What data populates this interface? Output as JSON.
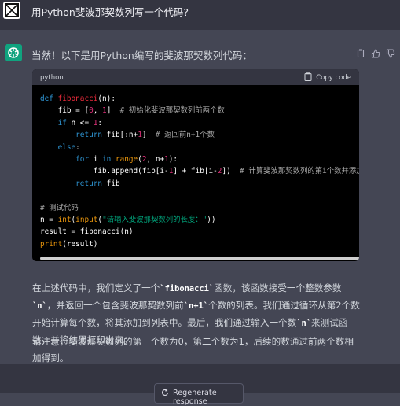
{
  "user_message": {
    "text": "用Python斐波那契数列写一个代码?"
  },
  "assistant": {
    "intro": "当然！以下是用Python编写的斐波那契数列代码：",
    "code_header": {
      "language": "python",
      "copy_label": "Copy code"
    },
    "code_lines": [
      [
        {
          "c": "kw",
          "t": "def "
        },
        {
          "c": "fn",
          "t": "fibonacci"
        },
        {
          "c": "",
          "t": "(n):"
        }
      ],
      [
        {
          "c": "",
          "t": "    fib = ["
        },
        {
          "c": "num",
          "t": "0"
        },
        {
          "c": "",
          "t": ", "
        },
        {
          "c": "num",
          "t": "1"
        },
        {
          "c": "",
          "t": "]  "
        },
        {
          "c": "cmt",
          "t": "# 初始化斐波那契数列前两个数"
        }
      ],
      [
        {
          "c": "",
          "t": "    "
        },
        {
          "c": "kw",
          "t": "if"
        },
        {
          "c": "",
          "t": " n <= "
        },
        {
          "c": "num",
          "t": "1"
        },
        {
          "c": "",
          "t": ":"
        }
      ],
      [
        {
          "c": "",
          "t": "        "
        },
        {
          "c": "kw",
          "t": "return"
        },
        {
          "c": "",
          "t": " fib[:n+"
        },
        {
          "c": "num",
          "t": "1"
        },
        {
          "c": "",
          "t": "]  "
        },
        {
          "c": "cmt",
          "t": "# 返回前n+1个数"
        }
      ],
      [
        {
          "c": "",
          "t": "    "
        },
        {
          "c": "kw",
          "t": "else"
        },
        {
          "c": "",
          "t": ":"
        }
      ],
      [
        {
          "c": "",
          "t": "        "
        },
        {
          "c": "kw",
          "t": "for"
        },
        {
          "c": "",
          "t": " i "
        },
        {
          "c": "kw",
          "t": "in"
        },
        {
          "c": "",
          "t": " "
        },
        {
          "c": "builtin",
          "t": "range"
        },
        {
          "c": "",
          "t": "("
        },
        {
          "c": "num",
          "t": "2"
        },
        {
          "c": "",
          "t": ", n+"
        },
        {
          "c": "num",
          "t": "1"
        },
        {
          "c": "",
          "t": "):"
        }
      ],
      [
        {
          "c": "",
          "t": "            fib.append(fib[i-"
        },
        {
          "c": "num",
          "t": "1"
        },
        {
          "c": "",
          "t": "] + fib[i-"
        },
        {
          "c": "num",
          "t": "2"
        },
        {
          "c": "",
          "t": "])  "
        },
        {
          "c": "cmt",
          "t": "# 计算斐波那契数列的第i个数并添加到列"
        }
      ],
      [
        {
          "c": "",
          "t": "        "
        },
        {
          "c": "kw",
          "t": "return"
        },
        {
          "c": "",
          "t": " fib"
        }
      ],
      [
        {
          "c": "",
          "t": ""
        }
      ],
      [
        {
          "c": "cmt",
          "t": "# 测试代码"
        }
      ],
      [
        {
          "c": "",
          "t": "n = "
        },
        {
          "c": "builtin",
          "t": "int"
        },
        {
          "c": "",
          "t": "("
        },
        {
          "c": "builtin",
          "t": "input"
        },
        {
          "c": "",
          "t": "("
        },
        {
          "c": "str",
          "t": "\"请输入斐波那契数列的长度：\""
        },
        {
          "c": "",
          "t": "))"
        }
      ],
      [
        {
          "c": "",
          "t": "result = fibonacci(n)"
        }
      ],
      [
        {
          "c": "builtin",
          "t": "print"
        },
        {
          "c": "",
          "t": "(result)"
        }
      ]
    ],
    "paragraph1": {
      "a": "在上述代码中，我们定义了一个",
      "code1": "`fibonacci`",
      "b": "函数，该函数接受一个整数参数",
      "code2": "`n`",
      "c": "，并返回一个包含斐波那契数列前",
      "code3": "`n+1`",
      "d": "个数的列表。我们通过循环从第2个数开始计算每个数，将其添加到列表中。最后，我们通过输入一个数",
      "code4": "`n`",
      "e": "来测试函数，并将结果打印出来。"
    },
    "paragraph2": "请注意，斐波那契数列的第一个数为0，第二个数为1，后续的数通过前两个数相加得到。"
  },
  "regenerate": {
    "label": "Regenerate response"
  },
  "colors": {
    "brand": "#10a37f",
    "bg_assistant": "#444654",
    "bg_user": "#343541"
  },
  "icons": [
    "user-avatar-icon",
    "openai-logo-icon",
    "copy-icon",
    "thumbs-up-icon",
    "thumbs-down-icon",
    "clipboard-icon",
    "refresh-icon"
  ]
}
